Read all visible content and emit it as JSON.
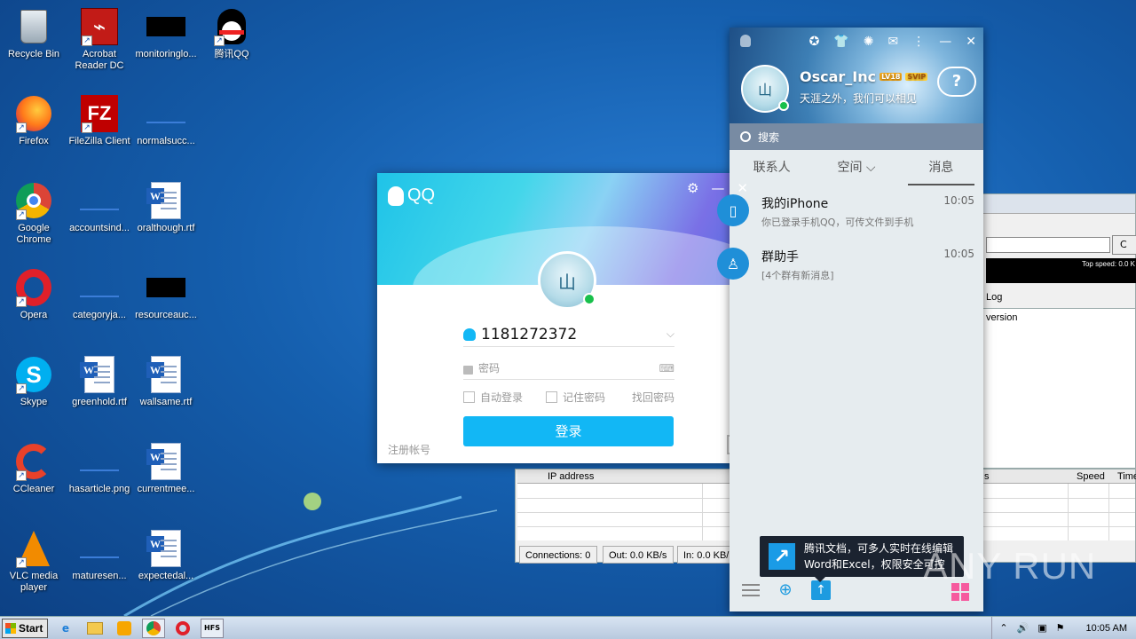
{
  "desktop": {
    "icons": [
      {
        "label": "Recycle Bin"
      },
      {
        "label": "Acrobat Reader DC"
      },
      {
        "label": "monitoringlo..."
      },
      {
        "label": "腾讯QQ"
      },
      {
        "label": "Firefox"
      },
      {
        "label": "FileZilla Client"
      },
      {
        "label": "normalsucc..."
      },
      {
        "label": "Google Chrome"
      },
      {
        "label": "accountsind..."
      },
      {
        "label": "oralthough.rtf"
      },
      {
        "label": "Opera"
      },
      {
        "label": "categoryja..."
      },
      {
        "label": "resourceauc..."
      },
      {
        "label": "Skype"
      },
      {
        "label": "greenhold.rtf"
      },
      {
        "label": "wallsame.rtf"
      },
      {
        "label": "CCleaner"
      },
      {
        "label": "hasarticle.png"
      },
      {
        "label": "currentmee..."
      },
      {
        "label": "VLC media player"
      },
      {
        "label": "maturesen..."
      },
      {
        "label": "expectedal..."
      }
    ]
  },
  "login": {
    "title": "QQ",
    "account": "1181272372",
    "password_placeholder": "密码",
    "auto_login": "自动登录",
    "remember_password": "记住密码",
    "forgot_password": "找回密码",
    "login_button": "登录",
    "register": "注册帐号",
    "avatar_text": "山"
  },
  "qq_main": {
    "nickname": "Oscar_Inc",
    "level_badge": "LV18",
    "vip_badge": "SVIP",
    "signature": "天涯之外，我们可以相见",
    "search_placeholder": "搜索",
    "tabs": [
      {
        "label": "联系人"
      },
      {
        "label": "空间 ⌵"
      },
      {
        "label": "消息"
      }
    ],
    "messages": [
      {
        "title": "我的iPhone",
        "subtitle": "你已登录手机QQ，可传文件到手机",
        "time": "10:05"
      },
      {
        "title": "群助手",
        "subtitle": "[4个群有新消息]",
        "time": "10:05"
      }
    ],
    "tooltip_line1": "腾讯文档，可多人实时在线编辑",
    "tooltip_line2": "Word和Excel，权限安全可控"
  },
  "bg_window": {
    "input_placeholder": "C",
    "top_speed": "Top speed: 0.0 K",
    "log_tab": "Log",
    "version_text": "version",
    "col_ip": "IP address",
    "col_s": "s",
    "col_speed": "Speed",
    "col_time": "Time",
    "status_connections": "Connections: 0",
    "status_out": "Out: 0.0 KB/s",
    "status_in": "In: 0.0 KB/"
  },
  "watermark": "ANY RUN",
  "taskbar": {
    "start_label": "Start",
    "clock": "10:05 AM"
  }
}
